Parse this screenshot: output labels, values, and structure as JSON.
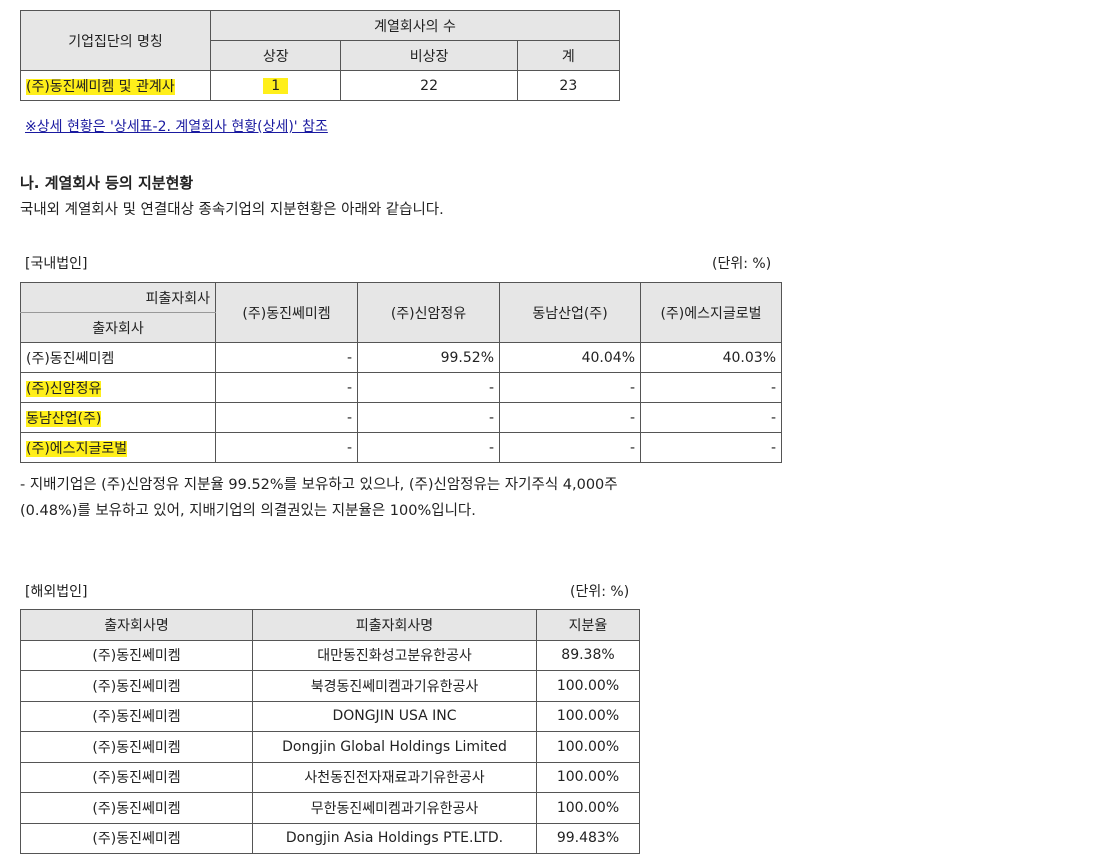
{
  "group_table": {
    "header_name": "기업집단의 명칭",
    "header_count": "계열회사의 수",
    "col_listed": "상장",
    "col_unlisted": "비상장",
    "col_total": "계",
    "row": {
      "name": "(주)동진쎄미켐 및 관계사",
      "listed": "1",
      "unlisted": "22",
      "total": "23"
    }
  },
  "detail_link": "※상세 현황은 '상세표-2. 계열회사 현황(상세)' 참조",
  "section": {
    "title": "나. 계열회사 등의 지분현황",
    "desc": "국내외 계열회사 및 연결대상 종속기업의 지분현황은 아래와 같습니다."
  },
  "domestic": {
    "caption": "[국내법인]",
    "unit": "(단위: %)",
    "header_investee": "피출자회사",
    "header_investor": "출자회사",
    "columns": [
      "(주)동진쎄미켐",
      "(주)신암정유",
      "동남산업(주)",
      "(주)에스지글로벌"
    ],
    "rows": [
      {
        "name": "(주)동진쎄미켐",
        "values": [
          "-",
          "99.52%",
          "40.04%",
          "40.03%"
        ]
      },
      {
        "name": "(주)신암정유",
        "values": [
          "-",
          "-",
          "-",
          "-"
        ]
      },
      {
        "name": "동남산업(주)",
        "values": [
          "-",
          "-",
          "-",
          "-"
        ]
      },
      {
        "name": "(주)에스지글로벌",
        "values": [
          "-",
          "-",
          "-",
          "-"
        ]
      }
    ],
    "note": "- 지배기업은 (주)신암정유 지분율 99.52%를 보유하고 있으나, (주)신암정유는 자기주식 4,000주(0.48%)를 보유하고 있어, 지배기업의 의결권있는 지분율은 100%입니다."
  },
  "overseas": {
    "caption": "[해외법인]",
    "unit": "(단위: %)",
    "headers": [
      "출자회사명",
      "피출자회사명",
      "지분율"
    ],
    "rows": [
      [
        "(주)동진쎄미켐",
        "대만동진화성고분유한공사",
        "89.38%"
      ],
      [
        "(주)동진쎄미켐",
        "북경동진쎄미켐과기유한공사",
        "100.00%"
      ],
      [
        "(주)동진쎄미켐",
        "DONGJIN USA INC",
        "100.00%"
      ],
      [
        "(주)동진쎄미켐",
        "Dongjin Global Holdings Limited",
        "100.00%"
      ],
      [
        "(주)동진쎄미켐",
        "사천동진전자재료과기유한공사",
        "100.00%"
      ],
      [
        "(주)동진쎄미켐",
        "무한동진쎄미켐과기유한공사",
        "100.00%"
      ],
      [
        "(주)동진쎄미켐",
        "Dongjin Asia Holdings PTE.LTD.",
        "99.483%"
      ]
    ]
  },
  "colors": {
    "header_bg": "#e6e6e6",
    "highlight": "#ffef1a",
    "link": "#1a1aa0"
  }
}
